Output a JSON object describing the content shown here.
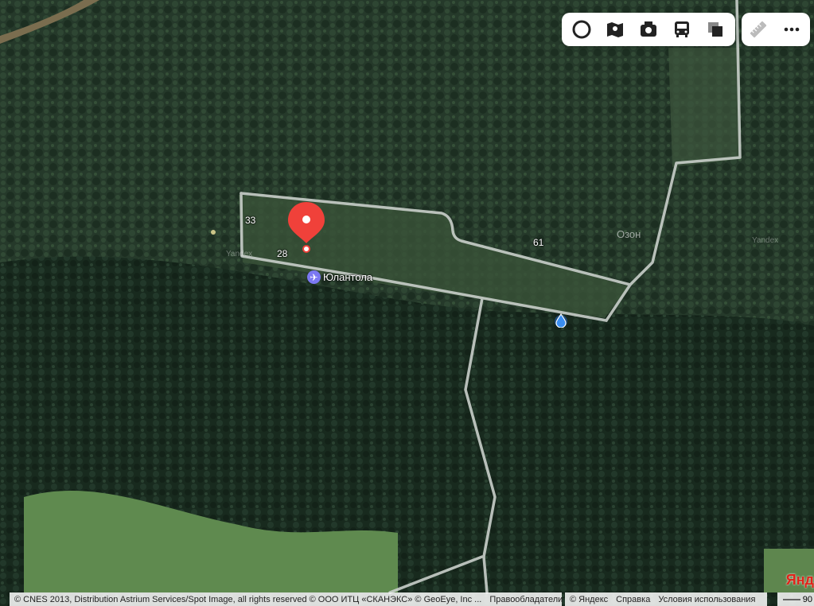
{
  "toolbar": {
    "layers": [
      {
        "name": "traffic-layer",
        "icon": "traffic-circle-icon"
      },
      {
        "name": "panorama-layer",
        "icon": "panorama-map-icon"
      },
      {
        "name": "photos-layer",
        "icon": "camera-icon"
      },
      {
        "name": "transit-layer",
        "icon": "bus-icon"
      },
      {
        "name": "map-type",
        "icon": "layers-icon"
      }
    ],
    "tools": [
      {
        "name": "ruler",
        "icon": "ruler-icon"
      },
      {
        "name": "more",
        "icon": "more-dots-icon"
      }
    ]
  },
  "map_labels": {
    "house_33": "33",
    "house_28": "28",
    "house_61": "61",
    "settlement": "Юлантола",
    "area_ozon": "Озон",
    "watermark_1": "Yandex",
    "watermark_2": "Yandex"
  },
  "marker": {
    "color": "#f0413a",
    "icon": "location-pin-icon"
  },
  "footer": {
    "attribution": "© CNES 2013, Distribution Astrium Services/Spot Image, all rights reserved © ООО ИТЦ «СКАНЭКС» © GeoEye, Inc ...",
    "rights_holders": "Правообладатели",
    "copyright": "© Яндекс",
    "help": "Справка",
    "terms": "Условия использования",
    "scale_value": "90",
    "logo": "Янд"
  }
}
